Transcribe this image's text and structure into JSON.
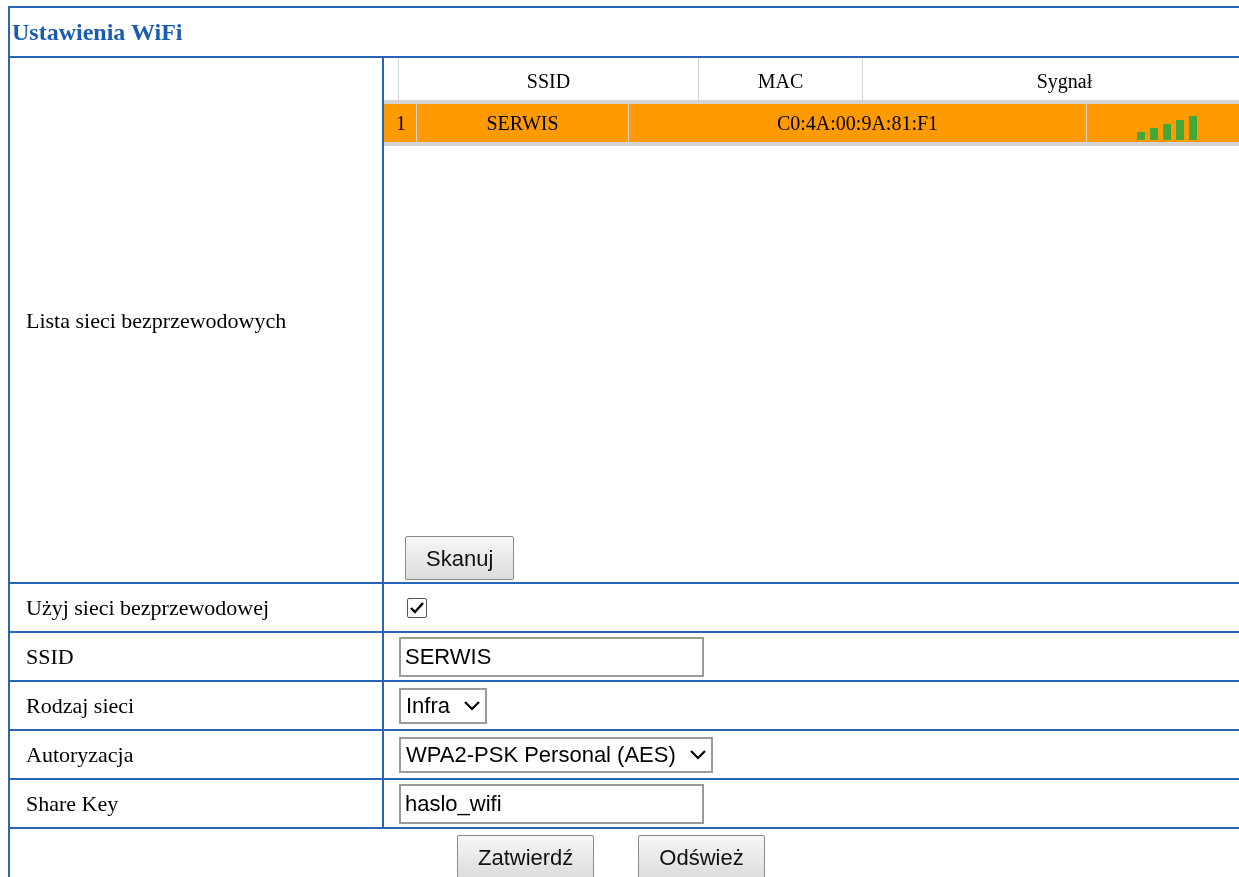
{
  "title": "Ustawienia WiFi",
  "network_list": {
    "label": "Lista sieci bezprzewodowych",
    "columns": [
      "SSID",
      "MAC",
      "Sygnał"
    ],
    "rows": [
      {
        "index": "1",
        "ssid": "SERWIS",
        "mac": "C0:4A:00:9A:81:F1",
        "selected": true
      }
    ],
    "scan_button": "Skanuj"
  },
  "fields": [
    {
      "kind": "checkbox",
      "label": "Użyj sieci bezprzewodowej",
      "checked": true
    },
    {
      "kind": "text",
      "label": "SSID",
      "value": "SERWIS"
    },
    {
      "kind": "select",
      "label": "Rodzaj sieci",
      "value": "Infra"
    },
    {
      "kind": "select",
      "label": "Autoryzacja",
      "value": "WPA2-PSK Personal (AES)"
    },
    {
      "kind": "text",
      "label": "Share Key",
      "value": "haslo_wifi"
    }
  ],
  "buttons": [
    "Zatwierdź",
    "Odśwież"
  ]
}
